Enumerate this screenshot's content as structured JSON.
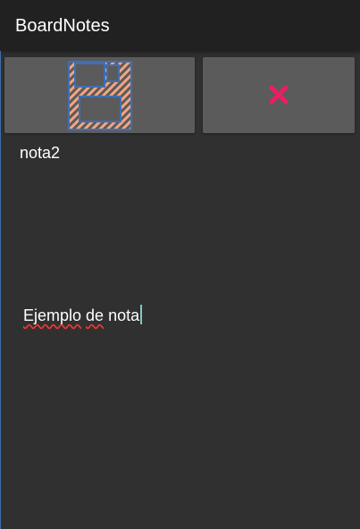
{
  "app_bar": {
    "title": "BoardNotes"
  },
  "toolbar": {
    "save_icon": "floppy-disk-icon",
    "delete_icon": "close-x-icon",
    "delete_color": "#e91e63",
    "save_icon_colors": {
      "outline": "#3f6fb5",
      "stripe": "#f4a582"
    }
  },
  "note": {
    "title": "nota2",
    "body_words": [
      "Ejemplo",
      "de",
      "nota"
    ]
  },
  "colors": {
    "background": "#303030",
    "app_bar": "#212121",
    "button": "#5b5b5b",
    "caret": "#80cbc4",
    "spellcheck_underline": "#e53935"
  }
}
